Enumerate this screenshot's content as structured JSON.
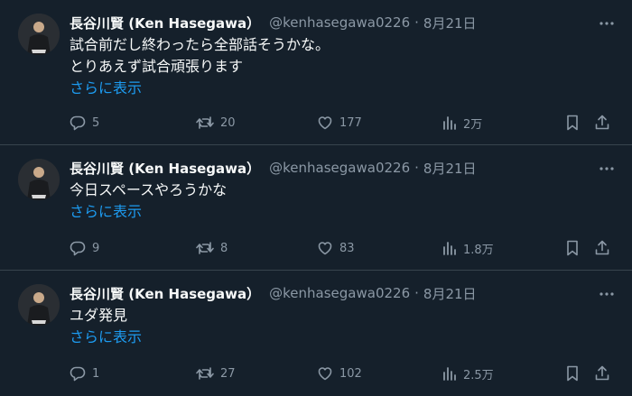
{
  "colors": {
    "background": "#15202b",
    "text": "#f7f9f9",
    "muted": "#8b98a5",
    "link": "#1d9bf0",
    "divider": "#38444d"
  },
  "icons": {
    "reply": "reply-icon",
    "retweet": "retweet-icon",
    "like": "heart-icon",
    "views": "views-bar-chart-icon",
    "bookmark": "bookmark-icon",
    "share": "share-upload-icon",
    "more": "more-dots-icon"
  },
  "tweets": [
    {
      "display_name": "長谷川賢 (Ken Hasegawa）",
      "handle": "@kenhasegawa0226",
      "separator": "·",
      "time": "8月21日",
      "lines": [
        "試合前だし終わったら全部話そうかな。",
        "とりあえず試合頑張ります"
      ],
      "show_more": "さらに表示",
      "replies": "5",
      "retweets": "20",
      "likes": "177",
      "views": "2万"
    },
    {
      "display_name": "長谷川賢 (Ken Hasegawa）",
      "handle": "@kenhasegawa0226",
      "separator": "·",
      "time": "8月21日",
      "lines": [
        "今日スペースやろうかな"
      ],
      "show_more": "さらに表示",
      "replies": "9",
      "retweets": "8",
      "likes": "83",
      "views": "1.8万"
    },
    {
      "display_name": "長谷川賢 (Ken Hasegawa）",
      "handle": "@kenhasegawa0226",
      "separator": "·",
      "time": "8月21日",
      "lines": [
        "ユダ発見"
      ],
      "show_more": "さらに表示",
      "replies": "1",
      "retweets": "27",
      "likes": "102",
      "views": "2.5万"
    }
  ]
}
